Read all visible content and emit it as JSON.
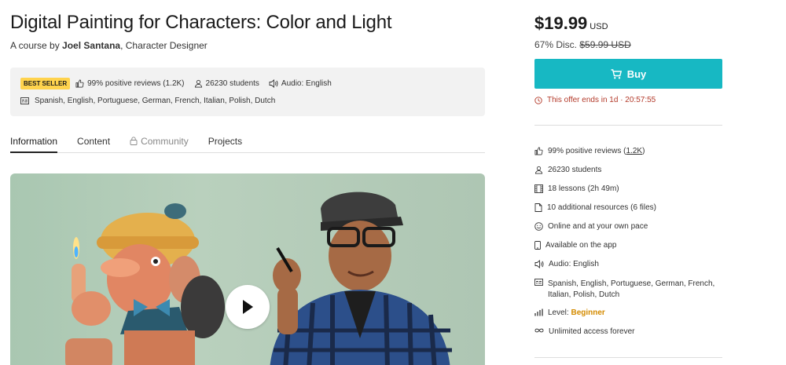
{
  "course": {
    "title": "Digital Painting for Characters: Color and Light",
    "byline_prefix": "A course by ",
    "author": "Joel Santana",
    "author_role": ", Character Designer"
  },
  "meta": {
    "badge": "BEST SELLER",
    "reviews": "99% positive reviews (1.2K)",
    "students": "26230 students",
    "audio": "Audio: English",
    "subtitles": "Spanish, English, Portuguese, German, French, Italian, Polish, Dutch"
  },
  "tabs": [
    {
      "label": "Information"
    },
    {
      "label": "Content"
    },
    {
      "label": "Community"
    },
    {
      "label": "Projects"
    }
  ],
  "video": {
    "play_icon": "play-icon"
  },
  "pricing": {
    "price": "$19.99",
    "currency": "USD",
    "discount_label": "67% Disc.",
    "original_price": "$59.99 USD",
    "buy_label": "Buy",
    "offer_text": "This offer ends in 1d · 20:57:55"
  },
  "features": {
    "reviews_prefix": "99% positive reviews (",
    "reviews_count": "1.2K",
    "reviews_suffix": ")",
    "students": "26230 students",
    "lessons": "18 lessons (2h 49m)",
    "resources": "10 additional resources (6 files)",
    "online": "Online and at your own pace",
    "app": "Available on the app",
    "audio": "Audio: English",
    "subtitles_line1": "Spanish, English, Portuguese, German, French,",
    "subtitles_line2": "Italian, Polish, Dutch",
    "level_prefix": "Level: ",
    "level_value": "Beginner",
    "access": "Unlimited access forever"
  },
  "colors": {
    "accent": "#17b8c3",
    "offer": "#b33a2a",
    "badge": "#ffd34d",
    "level": "#d48b00"
  }
}
